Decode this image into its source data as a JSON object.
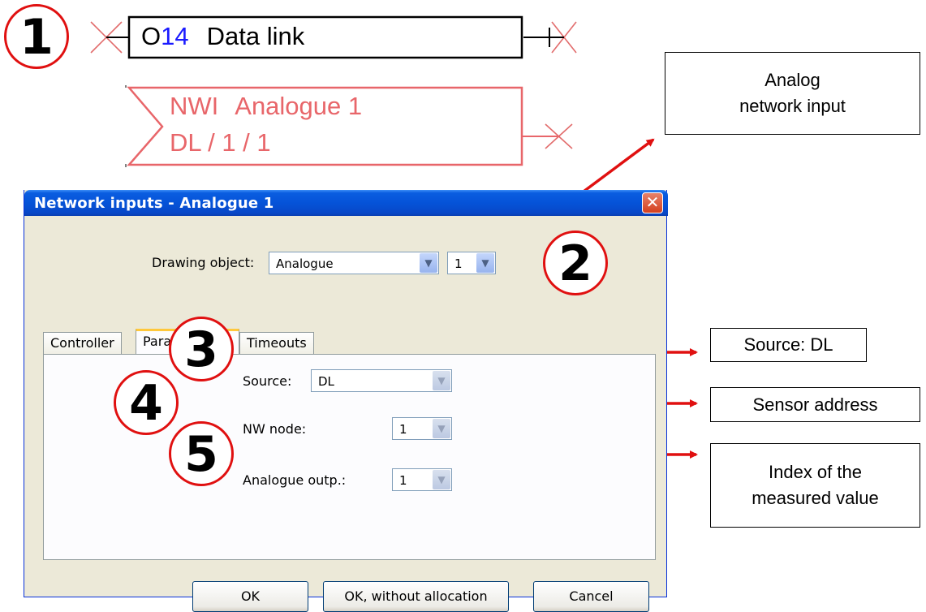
{
  "diagram": {
    "data_link_block": {
      "prefix": "O",
      "number": "14",
      "label": "Data link"
    },
    "network_input_block": {
      "line1_code": "NWI",
      "line1_label": "Analogue 1",
      "line2": "DL / 1 / 1"
    }
  },
  "callouts": {
    "analog_network_input": [
      "Analog",
      "network input"
    ],
    "source": "Source: DL",
    "sensor_address": "Sensor address",
    "index_measured_value": [
      "Index of the",
      "measured value"
    ]
  },
  "markers": [
    "1",
    "2",
    "3",
    "4",
    "5"
  ],
  "dialog": {
    "title": "Network inputs - Analogue 1",
    "close_glyph": "✕",
    "drawing_object": {
      "label": "Drawing object:",
      "value": "Analogue",
      "number": "1"
    },
    "tabs": [
      {
        "label": "Controller",
        "active": false
      },
      {
        "label": "Parameter",
        "active": true
      },
      {
        "label": "Timeouts",
        "active": false
      }
    ],
    "fields": {
      "source": {
        "label": "Source:",
        "value": "DL"
      },
      "nw_node": {
        "label": "NW node:",
        "value": "1"
      },
      "analogue_output": {
        "label": "Analogue outp.:",
        "value": "1"
      }
    },
    "buttons": {
      "ok": "OK",
      "ok_without_allocation": "OK, without allocation",
      "cancel": "Cancel"
    }
  },
  "colors": {
    "marker_red": "#e01010",
    "arrow_red": "#e01010",
    "block_pink": "#e8666a",
    "number_blue": "#1a1aff",
    "title_blue": "#0553d8"
  }
}
